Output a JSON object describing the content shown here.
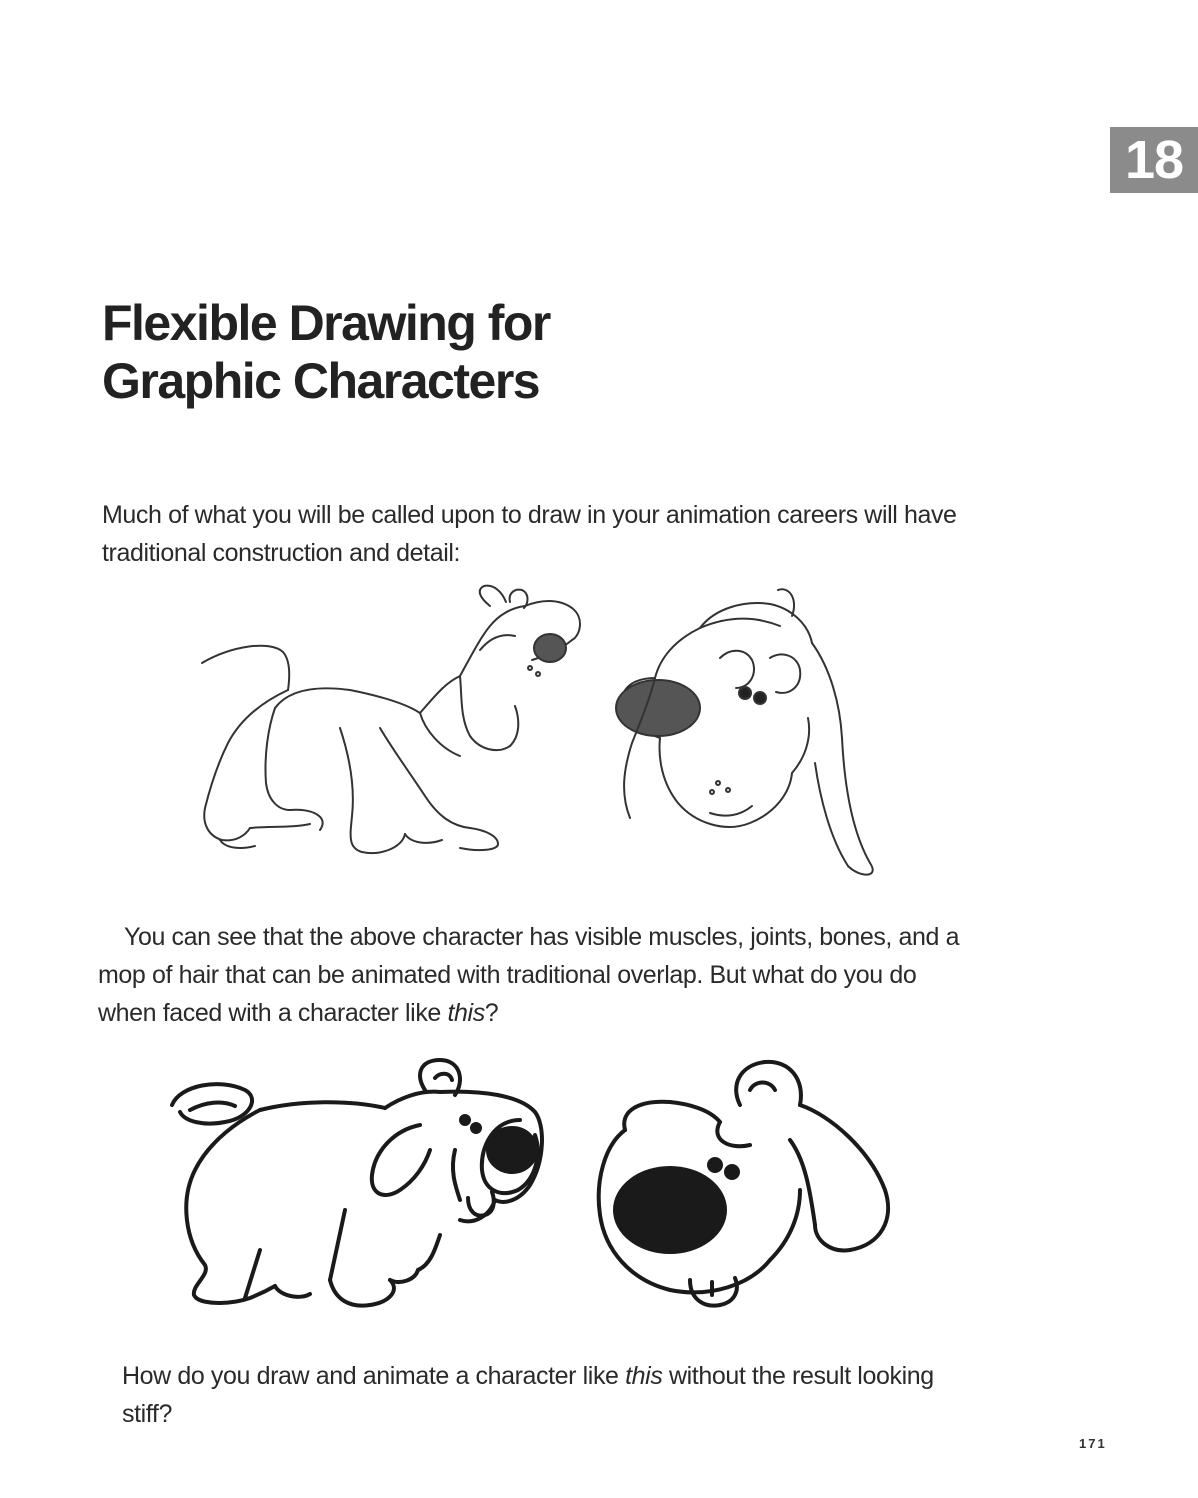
{
  "chapter": {
    "number": "18"
  },
  "title": {
    "line1": "Flexible Drawing for",
    "line2": "Graphic Characters"
  },
  "paragraphs": {
    "intro": "Much of what you will be called upon to draw in your animation careers will have traditional construction and detail:",
    "middle_before": "You can see that the above character has visible muscles, joints, bones, and a mop of hair that can be animated with traditional overlap. But what do you do when faced with a character like ",
    "middle_em": "this",
    "middle_after": "?",
    "closing_before": "How do you draw and animate a character like ",
    "closing_em": "this",
    "closing_after": " without the result looking stiff?"
  },
  "page_number": "171",
  "colors": {
    "chapter_tab": "#8b8b8b",
    "text": "#222222"
  }
}
